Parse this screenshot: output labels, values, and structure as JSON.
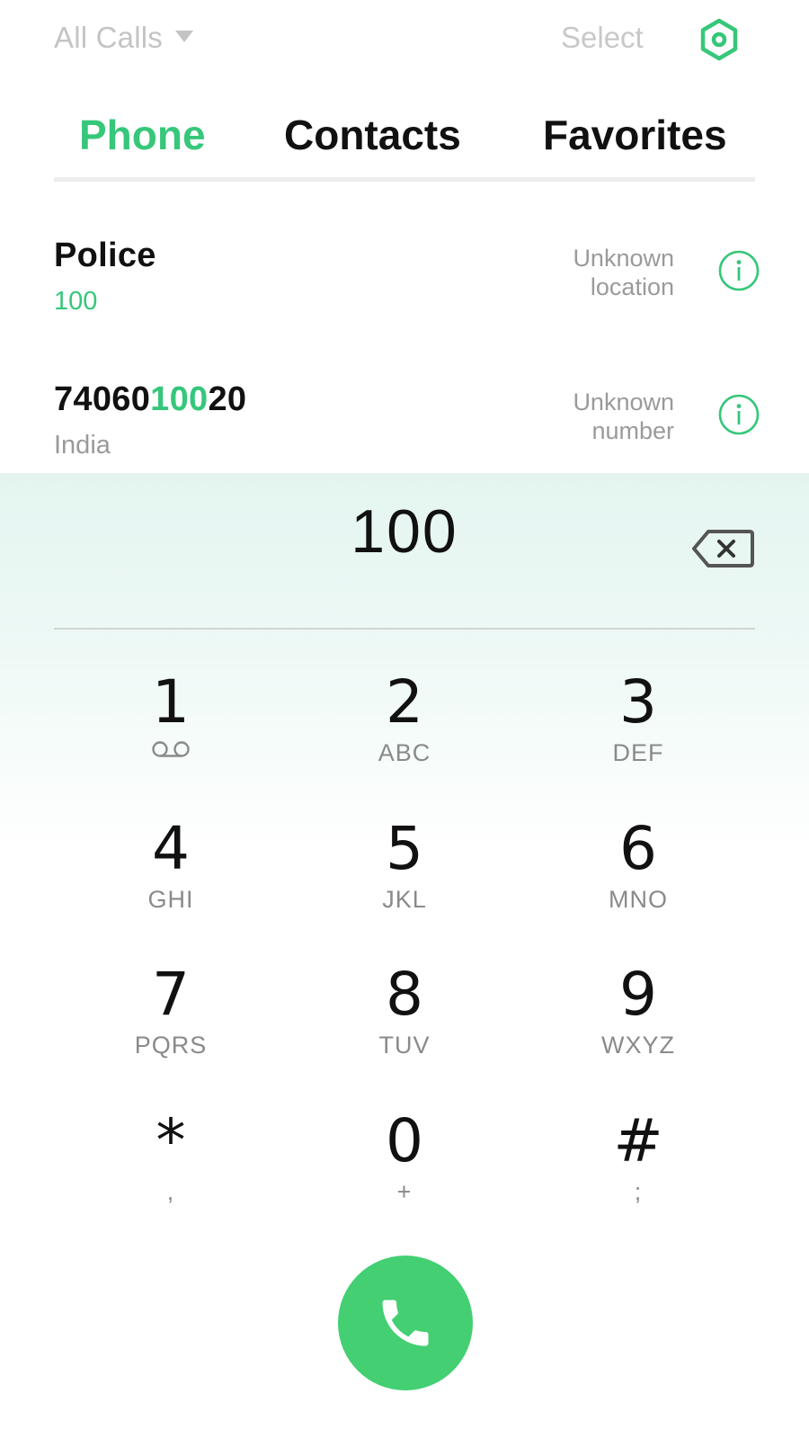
{
  "topbar": {
    "filter_label": "All Calls",
    "select_label": "Select"
  },
  "tabs": [
    {
      "label": "Phone",
      "active": true
    },
    {
      "label": "Contacts",
      "active": false
    },
    {
      "label": "Favorites",
      "active": false
    }
  ],
  "call_log": [
    {
      "title": "Police",
      "subtitle": "100",
      "status_line1": "Unknown",
      "status_line2": "location"
    },
    {
      "title_prefix": "74060",
      "title_match": "100",
      "title_suffix": "20",
      "subtitle": "India",
      "status_line1": "Unknown",
      "status_line2": "number"
    }
  ],
  "dialer": {
    "entered_number": "100",
    "keys": [
      {
        "digit": "1",
        "letters": ""
      },
      {
        "digit": "2",
        "letters": "ABC"
      },
      {
        "digit": "3",
        "letters": "DEF"
      },
      {
        "digit": "4",
        "letters": "GHI"
      },
      {
        "digit": "5",
        "letters": "JKL"
      },
      {
        "digit": "6",
        "letters": "MNO"
      },
      {
        "digit": "7",
        "letters": "PQRS"
      },
      {
        "digit": "8",
        "letters": "TUV"
      },
      {
        "digit": "9",
        "letters": "WXYZ"
      },
      {
        "digit": "*",
        "letters": ","
      },
      {
        "digit": "0",
        "letters": "+"
      },
      {
        "digit": "#",
        "letters": ";"
      }
    ]
  },
  "colors": {
    "accent": "#36c77a",
    "call_button": "#43cf72",
    "muted_text": "#9a9a9a",
    "panel_tint": "#e4f5f0"
  },
  "icons": {
    "filter": "caret-down-icon",
    "settings": "settings-hexagon-icon",
    "info": "info-circle-icon",
    "backspace": "backspace-icon",
    "voicemail": "voicemail-icon",
    "call": "phone-handset-icon"
  }
}
